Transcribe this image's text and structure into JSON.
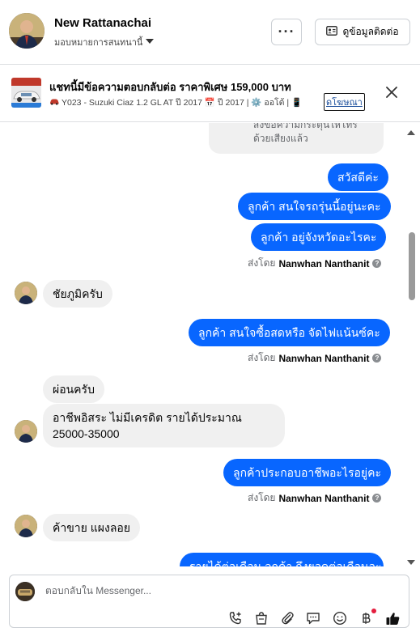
{
  "header": {
    "name": "New Rattanachai",
    "assign_label": "มอบหมายการสนทนานี้",
    "more_label": "···",
    "info_label": "ดูข้อมูลติดต่อ"
  },
  "ad": {
    "title": "แชทนี้มีข้อความตอบกลับต่อ ราคาพิเศษ 159,000 บาท",
    "subtitle": "Y023 - Suzuki Ciaz 1.2 GL AT ปี 2017 📅 ปี 2017 | ⚙️ ออโต้ | 📱",
    "link_label": "ดโฆษณา"
  },
  "messages": {
    "system_note": "ส่งข้อความกระตุ้นให้โทรด้วยเสียงแล้ว",
    "out1": "สวัสดีค่ะ",
    "out2": "ลูกค้า  สนใจรถรุ่นนี้อยู่นะคะ",
    "out3": "ลูกค้า  อยู่จังหวัดอะไรคะ",
    "in1": "ชัยภูมิครับ",
    "out4": "ลูกค้า สนใจซื้อสดหรือ จัดไฟแน้นซ์คะ",
    "in2": "ผ่อนครับ",
    "in3": "อาชีพอิสระ ไม่มีเครดิต รายได้ประมาณ 25000-35000",
    "out5": "ลูกค้าประกอบอาชีพอะไรอยู่คะ",
    "in4": "ค้าขาย แผงลอย",
    "out6": "รายได้ต่อเดือน ลูกค้า  ถึงยอดต่อเดือนอะ"
  },
  "sent_by": {
    "prefix": "ส่งโดย",
    "name": "Nanwhan Nanthanit",
    "help": "?"
  },
  "composer": {
    "placeholder": "ตอบกลับใน Messenger..."
  },
  "colors": {
    "accent": "#0866ff",
    "incoming_bubble": "#f0f0f0",
    "notification_dot": "#e41e3f"
  }
}
